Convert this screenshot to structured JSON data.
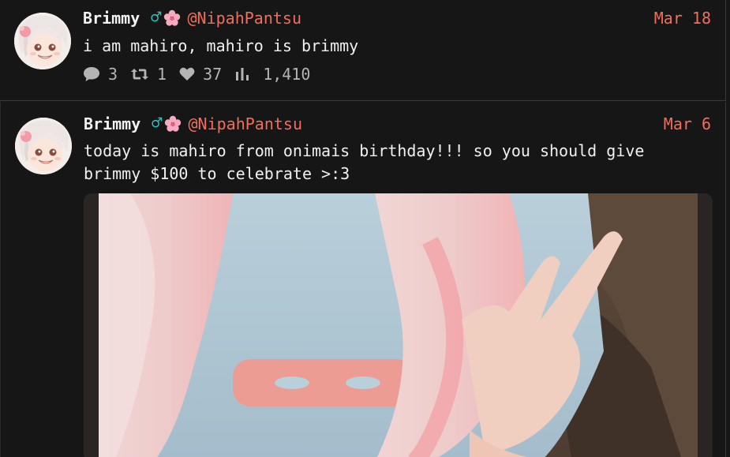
{
  "tweets": [
    {
      "display_name": "Brimmy",
      "gender_badge": "♂",
      "flower_badge": "cherry-blossom-icon",
      "handle": "@NipahPantsu",
      "date": "Mar 18",
      "text": "i am mahiro, mahiro is brimmy",
      "stats": {
        "replies": "3",
        "retweets": "1",
        "likes": "37",
        "views": "1,410"
      }
    },
    {
      "display_name": "Brimmy",
      "gender_badge": "♂",
      "flower_badge": "cherry-blossom-icon",
      "handle": "@NipahPantsu",
      "date": "Mar 6",
      "text": "today is mahiro from onimais birthday!!! so you should give\nbrimmy $100 to celebrate >:3",
      "media": "photo"
    }
  ],
  "colors": {
    "background": "#161616",
    "accent": "#f26d5b",
    "gender_badge": "#2ec7c0",
    "muted": "#b4b4b4",
    "divider": "#3a3a3a"
  }
}
